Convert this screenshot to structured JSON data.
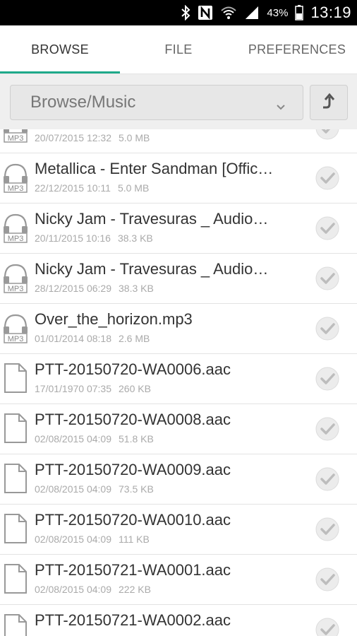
{
  "status_bar": {
    "icons": [
      "bluetooth-icon",
      "nfc-icon",
      "wifi-icon",
      "signal-icon",
      "battery-icon"
    ],
    "battery_percent": "43%",
    "time": "13:19"
  },
  "tabs": [
    {
      "label": "BROWSE",
      "active": true
    },
    {
      "label": "FILE",
      "active": false
    },
    {
      "label": "PREFERENCES",
      "active": false
    }
  ],
  "path_bar": {
    "current_path": "Browse/Music",
    "up_icon": "folder-up-icon",
    "dropdown_icon": "chevron-down-icon"
  },
  "files": [
    {
      "type": "mp3",
      "name": "",
      "date": "20/07/2015 12:32",
      "size": "5.0 MB"
    },
    {
      "type": "mp3",
      "name": "Metallica - Enter Sandman [Offic…",
      "date": "22/12/2015 10:11",
      "size": "5.0 MB"
    },
    {
      "type": "mp3",
      "name": "Nicky Jam - Travesuras _ Audio…",
      "date": "20/11/2015 10:16",
      "size": "38.3 KB"
    },
    {
      "type": "mp3",
      "name": "Nicky Jam - Travesuras _ Audio…",
      "date": "28/12/2015 06:29",
      "size": "38.3 KB"
    },
    {
      "type": "mp3",
      "name": "Over_the_horizon.mp3",
      "date": "01/01/2014 08:18",
      "size": "2.6 MB"
    },
    {
      "type": "file",
      "name": "PTT-20150720-WA0006.aac",
      "date": "17/01/1970 07:35",
      "size": "260 KB"
    },
    {
      "type": "file",
      "name": "PTT-20150720-WA0008.aac",
      "date": "02/08/2015 04:09",
      "size": "51.8 KB"
    },
    {
      "type": "file",
      "name": "PTT-20150720-WA0009.aac",
      "date": "02/08/2015 04:09",
      "size": "73.5 KB"
    },
    {
      "type": "file",
      "name": "PTT-20150720-WA0010.aac",
      "date": "02/08/2015 04:09",
      "size": "111 KB"
    },
    {
      "type": "file",
      "name": "PTT-20150721-WA0001.aac",
      "date": "02/08/2015 04:09",
      "size": "222 KB"
    },
    {
      "type": "file",
      "name": "PTT-20150721-WA0002.aac",
      "date": "",
      "size": ""
    }
  ],
  "colors": {
    "accent": "#1fa98a",
    "status_bar": "#000000",
    "path_bar_bg": "#efefef"
  }
}
